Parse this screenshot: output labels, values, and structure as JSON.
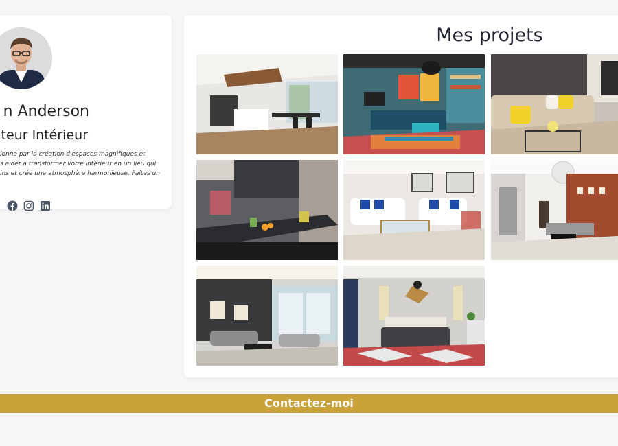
{
  "profile": {
    "name": "n Anderson",
    "role": "ateur Intérieur",
    "bio": "ionné par la création d'espaces magnifiques et\ns aider à transformer votre intérieur en un lieu qui\nins et crée une atmosphère harmonieuse. Faites un",
    "socials": [
      {
        "icon": "facebook-icon"
      },
      {
        "icon": "instagram-icon"
      },
      {
        "icon": "linkedin-icon"
      }
    ],
    "social_color": "#4a5565"
  },
  "projects": {
    "title": "Mes projets",
    "images": [
      {
        "name": "project-modern-kitchen-dining"
      },
      {
        "name": "project-colorful-living-room"
      },
      {
        "name": "project-yellow-cushion-lounge"
      },
      {
        "name": "project-dark-kitchen"
      },
      {
        "name": "project-white-sofa-living-room"
      },
      {
        "name": "project-brick-wall-living-room"
      },
      {
        "name": "project-grey-sofa-living-room"
      },
      {
        "name": "project-bedroom"
      }
    ]
  },
  "contact": {
    "label": "Contactez-moi",
    "color": "#c9a23a"
  }
}
